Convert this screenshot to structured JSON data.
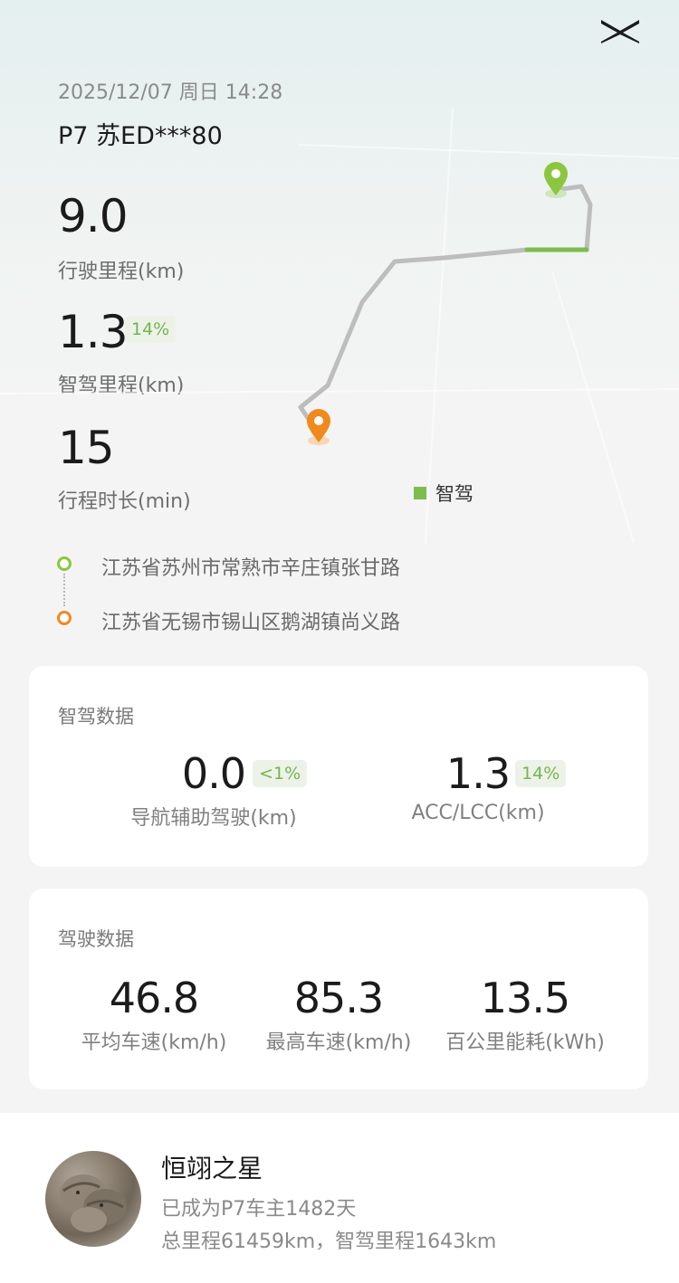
{
  "trip": {
    "datetime": "2025/12/07 周日 14:28",
    "vehicle": "P7 苏ED***80"
  },
  "stats": {
    "distance": {
      "value": "9.0",
      "label": "行驶里程(km)"
    },
    "smart_distance": {
      "value": "1.3",
      "pct": "14%",
      "label": "智驾里程(km)"
    },
    "duration": {
      "value": "15",
      "label": "行程时长(min)"
    }
  },
  "map": {
    "legend": "智驾",
    "colors": {
      "route": "#bdbdbd",
      "smart": "#7bbd4f",
      "start_pin": "#8cc63f",
      "end_pin": "#f08a1c"
    }
  },
  "route": {
    "start": "江苏省苏州市常熟市辛庄镇张甘路",
    "end": "江苏省无锡市锡山区鹅湖镇尚义路"
  },
  "smart_card": {
    "title": "智驾数据",
    "nav": {
      "value": "0.0",
      "pct": "<1%",
      "label": "导航辅助驾驶(km)"
    },
    "acc": {
      "value": "1.3",
      "pct": "14%",
      "label": "ACC/LCC(km)"
    }
  },
  "drive_card": {
    "title": "驾驶数据",
    "avg_speed": {
      "value": "46.8",
      "label": "平均车速(km/h)"
    },
    "max_speed": {
      "value": "85.3",
      "label": "最高车速(km/h)"
    },
    "consumption": {
      "value": "13.5",
      "label": "百公里能耗(kWh)"
    }
  },
  "owner": {
    "name": "恒翊之星",
    "tenure": "已成为P7车主1482天",
    "totals": "总里程61459km，智驾里程1643km"
  }
}
